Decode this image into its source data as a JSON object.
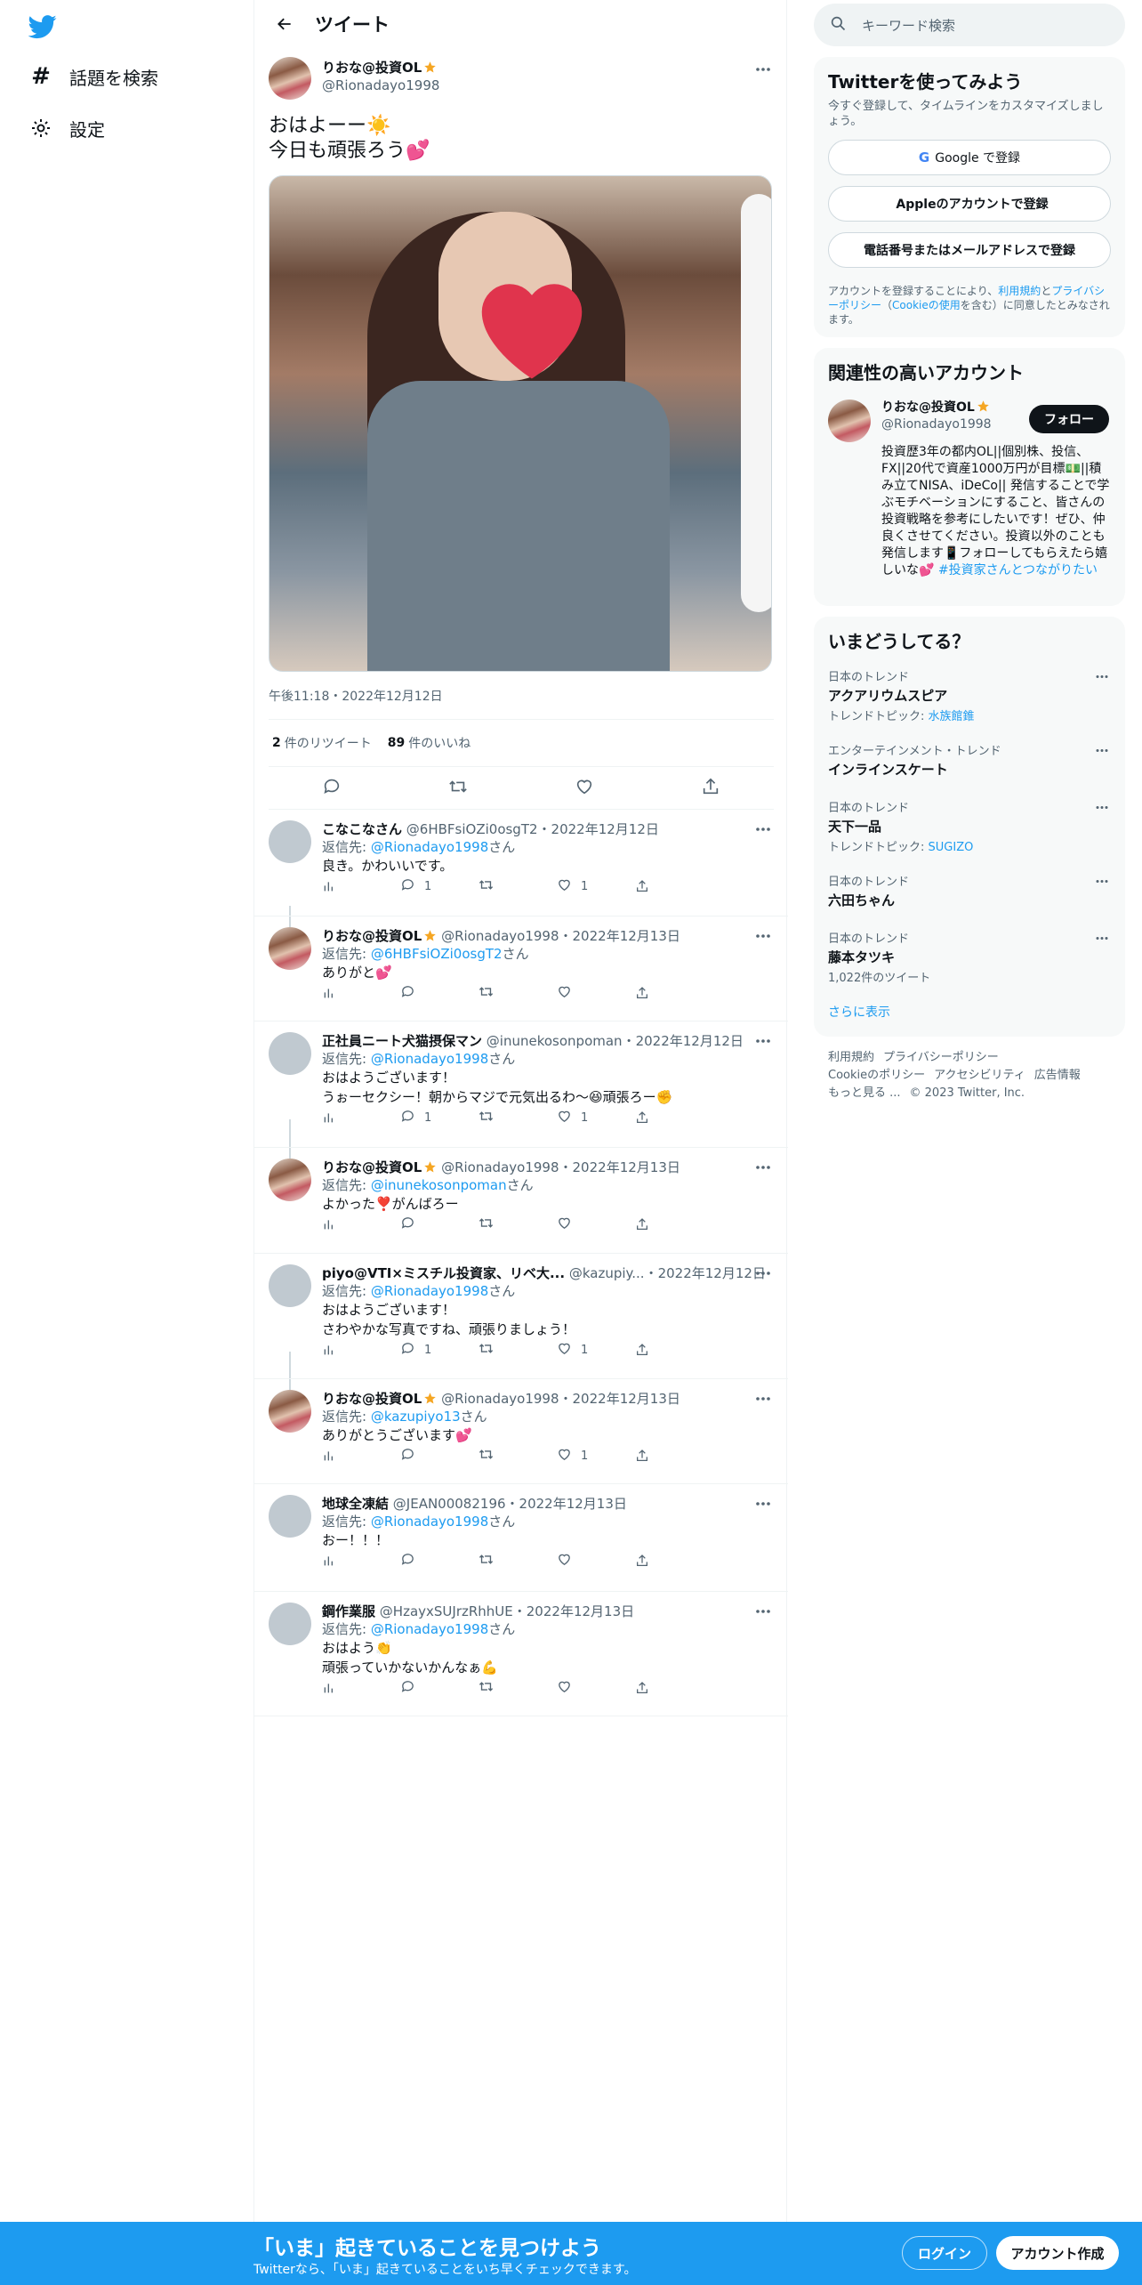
{
  "nav": {
    "explore": "話題を検索",
    "settings": "設定"
  },
  "header": {
    "title": "ツイート"
  },
  "tweet": {
    "name": "りおな@投資OL",
    "handle": "@Rionadayo1998",
    "text_line1": "おはよーー☀️",
    "text_line2": "今日も頑張ろう💕",
    "timestamp": "午後11:18・2022年12月12日",
    "retweets_count": "2",
    "retweets_label": "件のリツイート",
    "likes_count": "89",
    "likes_label": "件のいいね"
  },
  "replies": [
    {
      "name": "こなこなさん",
      "handle": "@6HBFsiOZi0osgT2",
      "date": "・2022年12月12日",
      "reply_to_prefix": "返信先: ",
      "reply_to": "@Rionadayo1998",
      "reply_to_suffix": "さん",
      "text": "良き。かわいいです。",
      "replies": "1",
      "retweets": "",
      "likes": "1"
    },
    {
      "name": "りおな@投資OL",
      "handle": "@Rionadayo1998",
      "date": "・2022年12月13日",
      "reply_to_prefix": "返信先: ",
      "reply_to": "@6HBFsiOZi0osgT2",
      "reply_to_suffix": "さん",
      "text": "ありがと💕",
      "replies": "",
      "retweets": "",
      "likes": ""
    },
    {
      "name": "正社員ニート犬猫摂保マン",
      "handle": "@inunekosonpoman",
      "date": "・2022年12月12日",
      "reply_to_prefix": "返信先: ",
      "reply_to": "@Rionadayo1998",
      "reply_to_suffix": "さん",
      "text": "おはようございます！",
      "text2": "うぉーセクシー！朝からマジで元気出るわ〜😆頑張ろー✊",
      "replies": "1",
      "retweets": "",
      "likes": "1"
    },
    {
      "name": "りおな@投資OL",
      "handle": "@Rionadayo1998",
      "date": "・2022年12月13日",
      "reply_to_prefix": "返信先: ",
      "reply_to": "@inunekosonpoman",
      "reply_to_suffix": "さん",
      "text": "よかった❣️がんばろー",
      "replies": "",
      "retweets": "",
      "likes": ""
    },
    {
      "name": "piyo@VTI×ミスチル投資家、リベ大...",
      "handle": "@kazupiy...",
      "date": "・2022年12月12日",
      "reply_to_prefix": "返信先: ",
      "reply_to": "@Rionadayo1998",
      "reply_to_suffix": "さん",
      "text": "おはようございます！",
      "text2": "さわやかな写真ですね、頑張りましょう！",
      "replies": "1",
      "retweets": "",
      "likes": "1"
    },
    {
      "name": "りおな@投資OL",
      "handle": "@Rionadayo1998",
      "date": "・2022年12月13日",
      "reply_to_prefix": "返信先: ",
      "reply_to": "@kazupiyo13",
      "reply_to_suffix": "さん",
      "text": "ありがとうございます💕",
      "replies": "",
      "retweets": "",
      "likes": "1"
    },
    {
      "name": "地球全凍結",
      "handle": "@JEAN00082196",
      "date": "・2022年12月13日",
      "reply_to_prefix": "返信先: ",
      "reply_to": "@Rionadayo1998",
      "reply_to_suffix": "さん",
      "text": "おー！！！",
      "replies": "",
      "retweets": "",
      "likes": ""
    },
    {
      "name": "鋼作業服",
      "handle": "@HzayxSUJrzRhhUE",
      "date": "・2022年12月13日",
      "reply_to_prefix": "返信先: ",
      "reply_to": "@Rionadayo1998",
      "reply_to_suffix": "さん",
      "text": "おはよう👏",
      "text2": "頑張っていかないかんなぁ💪",
      "replies": "",
      "retweets": "",
      "likes": ""
    }
  ],
  "sidebar": {
    "search_placeholder": "キーワード検索",
    "signup": {
      "title": "Twitterを使ってみよう",
      "subtitle": "今すぐ登録して、タイムラインをカスタマイズしましょう。",
      "google": "Google で登録",
      "apple": "Appleのアカウントで登録",
      "phone": "電話番号またはメールアドレスで登録",
      "legal_1": "アカウントを登録することにより、",
      "legal_terms": "利用規約",
      "legal_2": "と",
      "legal_privacy": "プライバシーポリシー",
      "legal_3": "（",
      "legal_cookie": "Cookieの使用",
      "legal_4": "を含む）に同意したとみなされます。"
    },
    "related": {
      "title": "関連性の高いアカウント",
      "name": "りおな@投資OL",
      "handle": "@Rionadayo1998",
      "follow": "フォロー",
      "bio": "投資歴3年の都内OL||個別株、投信、FX||20代で資産1000万円が目標💵||積み立てNISA、iDeCo|| 発信することで学ぶモチベーションにすること、皆さんの投資戦略を参考にしたいです！ぜひ、仲良くさせてください。投資以外のことも発信します📱フォローしてもらえたら嬉しいな💕 ",
      "bio_tag": "#投資家さんとつながりたい"
    },
    "trends": {
      "title": "いまどうしてる？",
      "items": [
        {
          "meta": "日本のトレンド",
          "name": "アクアリウムスピア",
          "sub_prefix": "トレンドトピック: ",
          "sub_link": "水族館錐"
        },
        {
          "meta": "エンターテインメント・トレンド",
          "name": "インラインスケート",
          "sub_prefix": "",
          "sub_link": ""
        },
        {
          "meta": "日本のトレンド",
          "name": "天下一品",
          "sub_prefix": "トレンドトピック: ",
          "sub_link": "SUGIZO"
        },
        {
          "meta": "日本のトレンド",
          "name": "六田ちゃん",
          "sub_prefix": "",
          "sub_link": ""
        },
        {
          "meta": "日本のトレンド",
          "name": "藤本タツキ",
          "sub_prefix": "1,022件のツイート",
          "sub_link": ""
        }
      ],
      "show_more": "さらに表示"
    },
    "footer": {
      "terms": "利用規約",
      "privacy": "プライバシーポリシー",
      "cookie": "Cookieのポリシー",
      "access": "アクセシビリティ",
      "ads": "広告情報",
      "more": "もっと見る ...",
      "copy": "© 2023 Twitter, Inc."
    }
  },
  "banner": {
    "title": "「いま」起きていることを見つけよう",
    "subtitle": "Twitterなら、「いま」起きていることをいち早くチェックできます。",
    "login": "ログイン",
    "signup": "アカウント作成"
  },
  "colors": {
    "accent": "#1d9bf0",
    "text": "#0f1419",
    "muted": "#536471"
  }
}
